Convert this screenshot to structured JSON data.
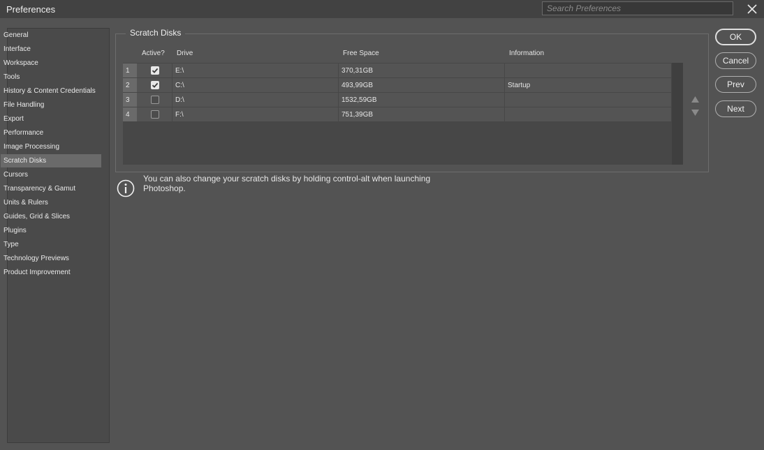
{
  "window": {
    "title": "Preferences"
  },
  "search": {
    "placeholder": "Search Preferences"
  },
  "sidebar": {
    "items": [
      {
        "label": "General"
      },
      {
        "label": "Interface"
      },
      {
        "label": "Workspace"
      },
      {
        "label": "Tools"
      },
      {
        "label": "History & Content Credentials"
      },
      {
        "label": "File Handling"
      },
      {
        "label": "Export"
      },
      {
        "label": "Performance"
      },
      {
        "label": "Image Processing"
      },
      {
        "label": "Scratch Disks",
        "selected": true
      },
      {
        "label": "Cursors"
      },
      {
        "label": "Transparency & Gamut"
      },
      {
        "label": "Units & Rulers"
      },
      {
        "label": "Guides, Grid & Slices"
      },
      {
        "label": "Plugins"
      },
      {
        "label": "Type"
      },
      {
        "label": "Technology Previews"
      },
      {
        "label": "Product Improvement"
      }
    ]
  },
  "scratch_disks": {
    "title": "Scratch Disks",
    "columns": {
      "active": "Active?",
      "drive": "Drive",
      "free": "Free Space",
      "info": "Information"
    },
    "rows": [
      {
        "num": "1",
        "active": true,
        "drive": "E:\\",
        "free": "370,31GB",
        "info": ""
      },
      {
        "num": "2",
        "active": true,
        "drive": "C:\\",
        "free": "493,99GB",
        "info": "Startup"
      },
      {
        "num": "3",
        "active": false,
        "drive": "D:\\",
        "free": "1532,59GB",
        "info": ""
      },
      {
        "num": "4",
        "active": false,
        "drive": "F:\\",
        "free": "751,39GB",
        "info": ""
      }
    ]
  },
  "buttons": {
    "ok": "OK",
    "cancel": "Cancel",
    "prev": "Prev",
    "next": "Next"
  },
  "info": {
    "message": "You can also change your scratch disks by holding control-alt when launching Photoshop."
  },
  "colors": {
    "background": "#535353",
    "titlebar": "#424242",
    "selected": "#6a6a6a"
  }
}
